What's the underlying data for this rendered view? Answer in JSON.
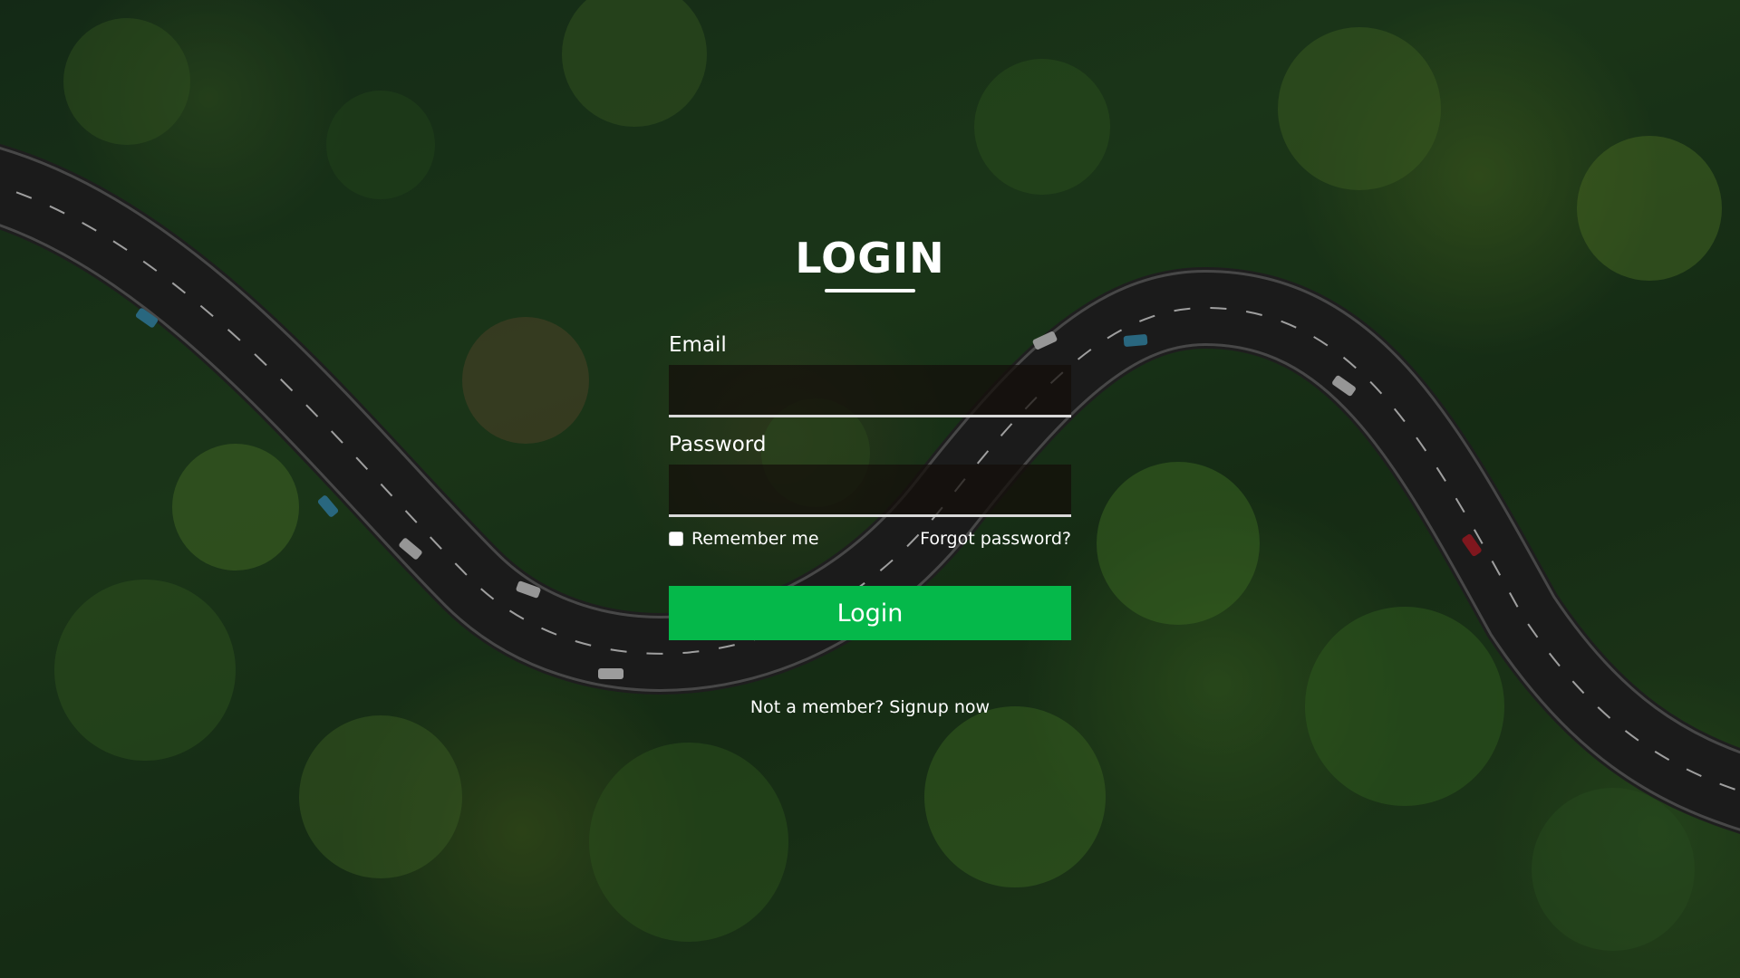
{
  "login": {
    "title": "LOGIN",
    "email_label": "Email",
    "email_value": "",
    "password_label": "Password",
    "password_value": "",
    "remember_label": "Remember me",
    "remember_checked": false,
    "forgot_label": "Forgot password?",
    "button_label": "Login",
    "signup_prompt": "Not a member?",
    "signup_link": "Signup now"
  },
  "colors": {
    "accent": "#05b84a",
    "text": "#ffffff",
    "input_background": "#140e0a",
    "forest": "#1e3d1d",
    "road": "#2a2a2a"
  }
}
